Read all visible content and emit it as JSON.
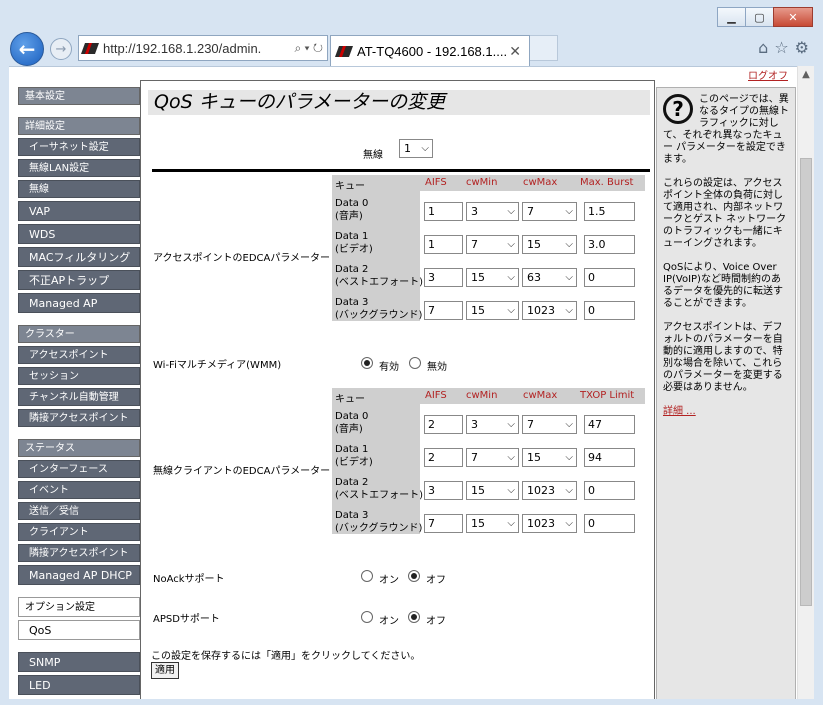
{
  "browser": {
    "url": "http://192.168.1.230/admin.",
    "tab_title": "AT-TQ4600 - 192.168.1....",
    "back_glyph": "←",
    "fwd_glyph": "→"
  },
  "logout": "ログオフ",
  "sidebar": {
    "items": [
      {
        "type": "head",
        "label": "基本設定"
      },
      {
        "type": "head",
        "label": "詳細設定"
      },
      {
        "type": "item",
        "label": "イーサネット設定"
      },
      {
        "type": "item",
        "label": "無線LAN設定"
      },
      {
        "type": "item",
        "label": "無線"
      },
      {
        "type": "item-big",
        "label": "VAP"
      },
      {
        "type": "item-big",
        "label": "WDS"
      },
      {
        "type": "item-big",
        "label": "MACフィルタリング"
      },
      {
        "type": "item-big",
        "label": "不正APトラップ"
      },
      {
        "type": "item-big",
        "label": "Managed AP"
      },
      {
        "type": "head",
        "label": "クラスター"
      },
      {
        "type": "item",
        "label": "アクセスポイント"
      },
      {
        "type": "item",
        "label": "セッション"
      },
      {
        "type": "item",
        "label": "チャンネル自動管理"
      },
      {
        "type": "item",
        "label": "隣接アクセスポイント"
      },
      {
        "type": "head",
        "label": "ステータス"
      },
      {
        "type": "item",
        "label": "インターフェース"
      },
      {
        "type": "item",
        "label": "イベント"
      },
      {
        "type": "item",
        "label": "送信／受信"
      },
      {
        "type": "item",
        "label": "クライアント"
      },
      {
        "type": "item",
        "label": "隣接アクセスポイント"
      },
      {
        "type": "item-big",
        "label": "Managed AP DHCP"
      },
      {
        "type": "plain",
        "label": "オプション設定"
      },
      {
        "type": "plain-sel",
        "label": "QoS"
      },
      {
        "type": "item-big",
        "label": "SNMP"
      },
      {
        "type": "item-big",
        "label": "LED"
      }
    ]
  },
  "main": {
    "title": "QoS キューのパラメーターの変更",
    "radio_label": "無線",
    "radio_select": "1",
    "ap_edca": {
      "label": "アクセスポイントのEDCAパラメーター",
      "headers": [
        "キュー",
        "AIFS",
        "cwMin",
        "cwMax",
        "Max. Burst"
      ],
      "rows": [
        {
          "q1": "Data 0",
          "q2": "(音声)",
          "aifs": "1",
          "cwmin": "3",
          "cwmax": "7",
          "last": "1.5"
        },
        {
          "q1": "Data 1",
          "q2": "(ビデオ)",
          "aifs": "1",
          "cwmin": "7",
          "cwmax": "15",
          "last": "3.0"
        },
        {
          "q1": "Data 2",
          "q2": "(ベストエフォート)",
          "aifs": "3",
          "cwmin": "15",
          "cwmax": "63",
          "last": "0"
        },
        {
          "q1": "Data 3",
          "q2": "(バックグラウンド)",
          "aifs": "7",
          "cwmin": "15",
          "cwmax": "1023",
          "last": "0"
        }
      ]
    },
    "wmm": {
      "label": "Wi-Fiマルチメディア(WMM)",
      "on_label": "有効",
      "off_label": "無効"
    },
    "client_edca": {
      "label": "無線クライアントのEDCAパラメーター",
      "headers": [
        "キュー",
        "AIFS",
        "cwMin",
        "cwMax",
        "TXOP Limit"
      ],
      "rows": [
        {
          "q1": "Data 0",
          "q2": "(音声)",
          "aifs": "2",
          "cwmin": "3",
          "cwmax": "7",
          "last": "47"
        },
        {
          "q1": "Data 1",
          "q2": "(ビデオ)",
          "aifs": "2",
          "cwmin": "7",
          "cwmax": "15",
          "last": "94"
        },
        {
          "q1": "Data 2",
          "q2": "(ベストエフォート)",
          "aifs": "3",
          "cwmin": "15",
          "cwmax": "1023",
          "last": "0"
        },
        {
          "q1": "Data 3",
          "q2": "(バックグラウンド)",
          "aifs": "7",
          "cwmin": "15",
          "cwmax": "1023",
          "last": "0"
        }
      ]
    },
    "noack": {
      "label": "NoAckサポート",
      "on_label": "オン",
      "off_label": "オフ"
    },
    "apsd": {
      "label": "APSDサポート",
      "on_label": "オン",
      "off_label": "オフ"
    },
    "save_hint": "この設定を保存するには「適用」をクリックしてください。",
    "apply_label": "適用"
  },
  "help": {
    "icon": "?",
    "p1": "このページでは、異なるタイプの無線トラフィックに対して、それぞれ異なったキュー パラメーターを設定できます。",
    "p2": "これらの設定は、アクセスポイント全体の負荷に対して適用され、内部ネットワークとゲスト ネットワークのトラフィックも一緒にキューイングされます。",
    "p3": "QoSにより、Voice Over IP(VoIP)など時間制約のあるデータを優先的に転送することができます。",
    "p4": "アクセスポイントは、デフォルトのパラメーターを自動的に適用しますので、特別な場合を除いて、これらのパラメーターを変更する必要はありません。",
    "more": "詳細 ..."
  }
}
